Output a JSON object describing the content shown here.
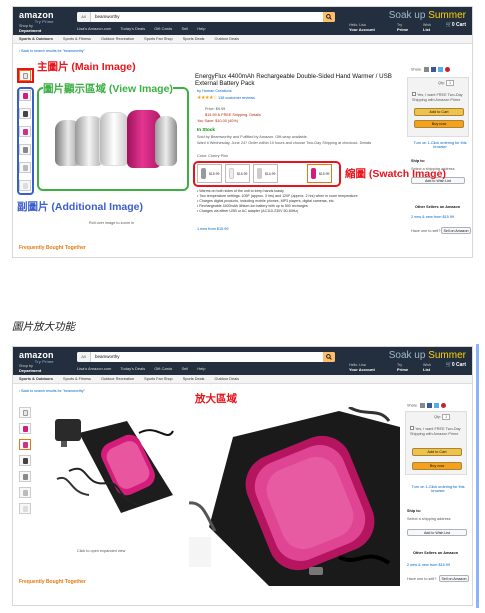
{
  "header": {
    "logo": "amazon",
    "logo_sub": "Try Prime",
    "search_category": "All",
    "search_query": "beamworthy",
    "promo_prefix": "Soak up ",
    "promo_highlight": "Summer",
    "shop_by_label": "Shop by",
    "department_label": "Department",
    "nav_items": [
      "Lisa's Amazon.com",
      "Today's Deals",
      "Gift Cards",
      "Sell",
      "Help"
    ],
    "hello": "Hello. Lisa",
    "your_account": "Your Account",
    "try_label": "Try",
    "prime_label": "Prime",
    "wish_label": "Wish",
    "list_label": "List",
    "cart_count": "0",
    "cart_label": "Cart"
  },
  "subnav": [
    "Sports & Outdoors",
    "Sports & Fitness",
    "Outdoor Recreation",
    "Sports Fan Shop",
    "Sports Deals",
    "Outdoor Deals"
  ],
  "back_link": "‹ Back to search results for \"beamworthy\"",
  "product": {
    "title": "EnergyFlux 4400mAh Rechargeable Double-Sided Hand Warmer / USB External Battery Pack",
    "by": "by Human Creations",
    "reviews": "138 customer reviews",
    "list_price": "Price: $9.99",
    "price": "$15.99 & FREE Shipping. Details",
    "save": "You Save: $10.00 (40%)",
    "stock": "In Stock",
    "sold_by": "Sold by Beamworthy and Fulfilled by Amazon. Gift-wrap available.",
    "delivery": "Want it Wednesday, June 24? Order within 10 hours and choose Two-Day Shipping at checkout. Details",
    "color_label": "Color: Cherry Pink",
    "swatch_prices": [
      "$15.99",
      "$15.99",
      "$14.99",
      "$15.99"
    ],
    "bullets": [
      "Warms on both sides of the unit to keep hands toasty",
      "Two temperature settings: 105F (approx. 3 hrs) and 120F (approx. 2 hrs) when in room temperature",
      "Charges digital products, including mobile phones, MP3 players, digital cameras, etc.",
      "Rechargeable 4400mAh lithium-ion battery with up to 500 recharges",
      "Charges via either USB or AC adapter (AC110-230V 50-60Hz)"
    ],
    "roll_over": "Roll over image to zoom in",
    "click_open": "Click to open expanded view",
    "new_from": "1 new from $15.99"
  },
  "buybox": {
    "share": "Share",
    "qty_label": "Qty:",
    "qty": "1",
    "prime_offer": "Yes, I want FREE Two-Day Shipping with Amazon Prime",
    "add_to_cart": "Add to Cart",
    "buy_now": "Buy now",
    "one_click": "Turn on 1-Click ordering for this browser",
    "ship_to": "Ship to:",
    "address": "Select a shipping address",
    "wish_list": "Add to Wish List",
    "other_sellers": "Other Sellers on Amazon",
    "new_sellers": "2 new & new from $15.99",
    "sell_on": "Have one to sell?",
    "sell_btn": "Sell on Amazon"
  },
  "fbt": "Frequently Bought Together",
  "annotations": {
    "main_image": "主圖片 (Main Image)",
    "view_image": "圖片顯示區域 (View Image)",
    "swatch_image": "縮圖 (Swatch Image)",
    "additional_image": "副圖片 (Additional Image)",
    "zoom_area": "放大區域"
  },
  "caption": "圖片放大功能",
  "colors": {
    "header_bg": "#232f3e",
    "annotation_red": "#e8141c",
    "annotation_green": "#3cb043",
    "annotation_blue": "#3a5fcd",
    "link_blue": "#0066c0",
    "price_red": "#b12704",
    "pink_product": "#d41d7a"
  }
}
